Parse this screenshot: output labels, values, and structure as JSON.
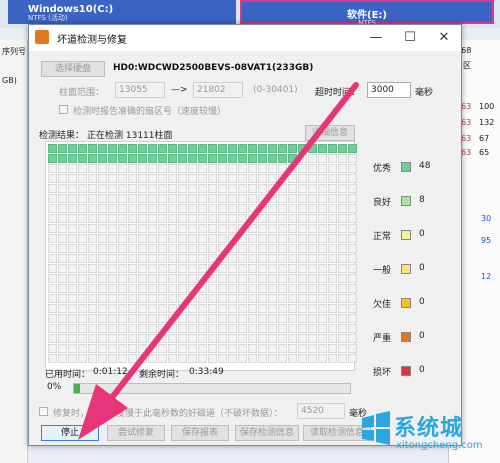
{
  "background": {
    "disk1_label": "Windows10(C:)",
    "disk1_sub": "NTFS (活动)",
    "disk2_label": "软件(E:)",
    "disk2_sub": "NTFS",
    "left_header": "序列号",
    "left_cap": "GB)",
    "right_header": "7168",
    "right_col1_label": "区",
    "right_values": [
      "63",
      "63",
      "63",
      "63"
    ],
    "right_values2": [
      "100",
      "132",
      "67",
      "65"
    ],
    "right_blue": [
      "30",
      "95",
      "12"
    ]
  },
  "dialog": {
    "title": "坏道检测与修复",
    "minimize": "—",
    "maximize": "☐",
    "close": "✕",
    "select_disk_label": "选择硬盘",
    "disk_model": "HD0:WDCWD2500BEVS-08VAT1(233GB)",
    "cyl_range_label": "柱面范围：",
    "cyl_start": "13055",
    "cyl_arrow": "—>",
    "cyl_end": "21802",
    "cyl_total": "(0-30401)",
    "timeout_label": "超时时间：",
    "timeout_value": "3000",
    "timeout_unit": "毫秒",
    "report_sector_label": "检测时报告准确的扇区号（速度较慢）",
    "result_label": "检测结果：",
    "status_text": "正在检测  13111柱面",
    "detail_btn": "详细信息",
    "used_time_label": "已用时间：",
    "used_time": "0:01:12",
    "remaining_label": "剩余时间：",
    "remaining": "0:33:49",
    "progress_text": "0%",
    "progress": 0.02,
    "repair_label": "修复时，读写速度慢于此毫秒数的好磁道（不破坏数据）：",
    "repair_ms": "4520",
    "repair_unit": "毫秒",
    "buttons": {
      "stop": "停止",
      "try_repair": "尝试修复",
      "save_report": "保存报表",
      "save_info": "保存检测信息",
      "read_info": "读取检测信息"
    }
  },
  "legend": [
    {
      "name": "优秀",
      "count": "48",
      "color": "#6fcf97"
    },
    {
      "name": "良好",
      "count": "8",
      "color": "#a8e6a0"
    },
    {
      "name": "正常",
      "count": "0",
      "color": "#f5f09a"
    },
    {
      "name": "一般",
      "count": "0",
      "color": "#f7e27a"
    },
    {
      "name": "欠佳",
      "count": "0",
      "color": "#f5c023"
    },
    {
      "name": "严重",
      "count": "0",
      "color": "#e07a1f"
    },
    {
      "name": "损坏",
      "count": "0",
      "color": "#d9363e"
    }
  ],
  "grid": {
    "columns": 31,
    "rows": 22,
    "done": 48,
    "good": 8
  },
  "watermark": {
    "text": "系统城",
    "url": "xitongcheng.com"
  }
}
